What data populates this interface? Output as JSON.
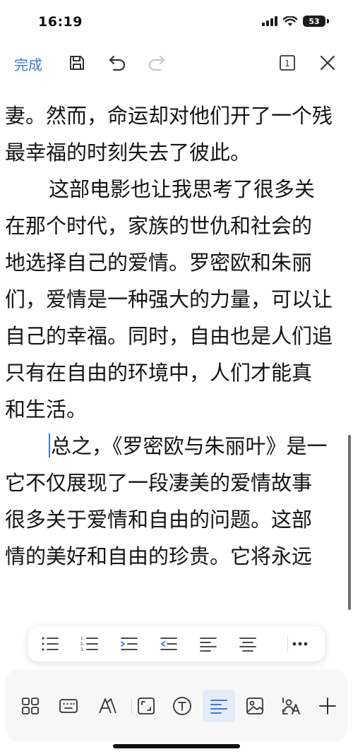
{
  "status": {
    "time": "16:19",
    "battery": "53"
  },
  "toolbar": {
    "done_label": "完成",
    "page_count": "1",
    "accent": "#3b7bd8"
  },
  "document": {
    "lines": [
      "妻。然而，命运却对他们开了一个残",
      "最幸福的时刻失去了彼此。",
      "这部电影也让我思考了很多关",
      "在那个时代，家族的世仇和社会的",
      "地选择自己的爱情。罗密欧和朱丽",
      "们，爱情是一种强大的力量，可以让",
      "自己的幸福。同时，自由也是人们追",
      "只有在自由的环境中，人们才能真",
      "和生活。",
      "总之，《罗密欧与朱丽叶》是一",
      "它不仅展现了一段凄美的爱情故事",
      "很多关于爱情和自由的问题。这部",
      "情的美好和自由的珍贵。它将永远"
    ]
  },
  "format_bar": {
    "items": [
      "bullet-list-icon",
      "numbered-list-icon",
      "increase-indent-icon",
      "decrease-indent-icon",
      "align-left-icon",
      "align-center-icon",
      "more-icon"
    ]
  },
  "bottom_bar": {
    "items": [
      "grid-icon",
      "keyboard-icon",
      "text-style-icon",
      "fit-screen-icon",
      "text-box-icon",
      "paragraph-icon",
      "image-icon",
      "translate-icon",
      "add-icon"
    ],
    "active": "paragraph-icon"
  }
}
